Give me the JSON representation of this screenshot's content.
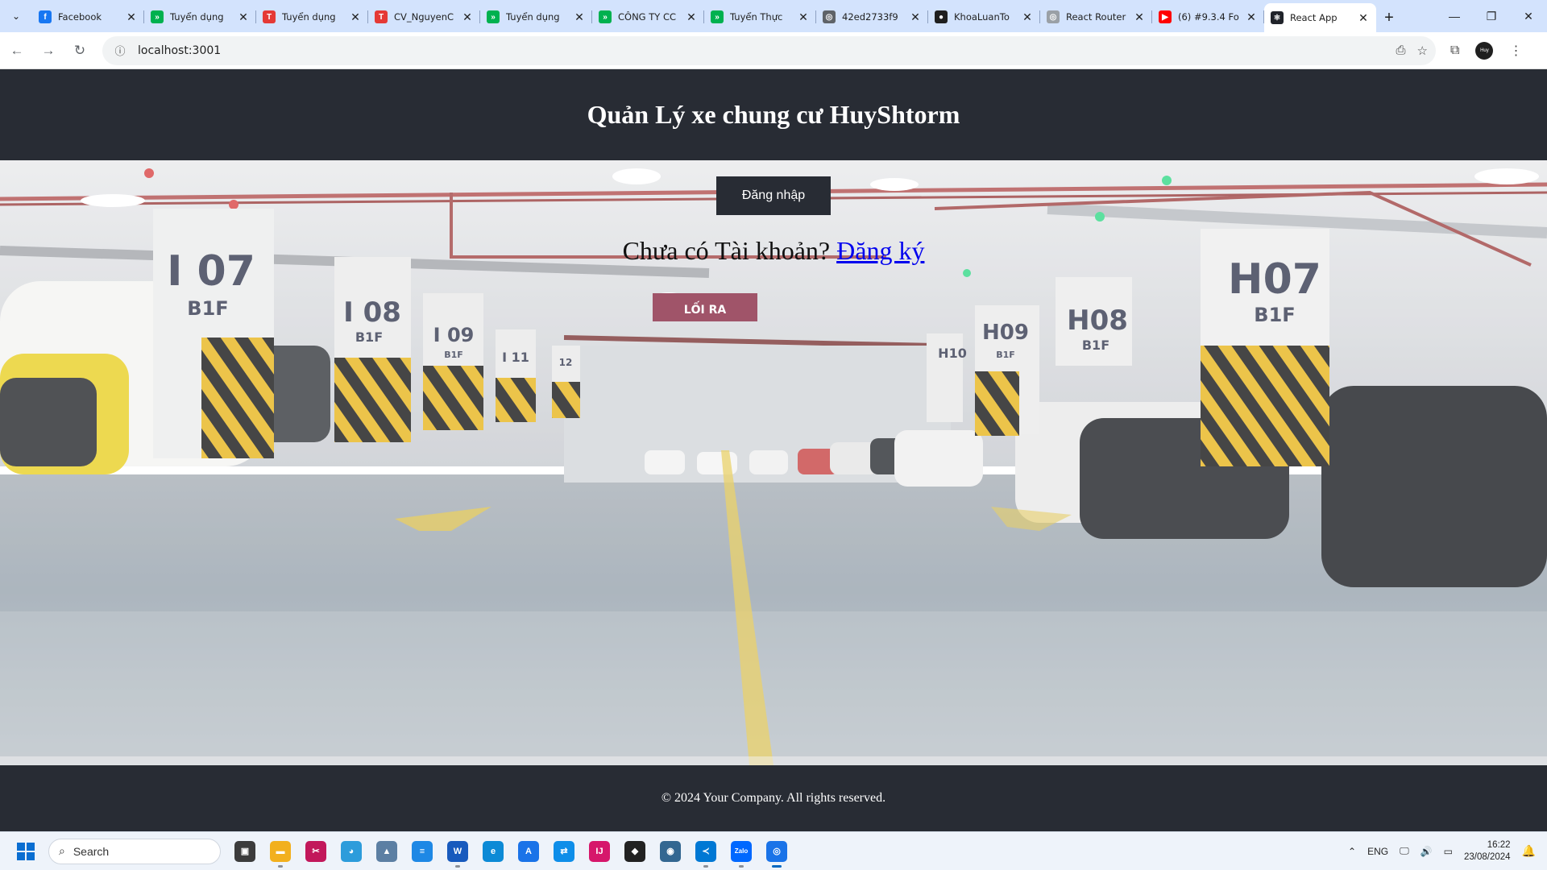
{
  "browser": {
    "tabs": [
      {
        "title": "Facebook",
        "icon": "facebook-icon",
        "color": "#1877f2",
        "glyph": "f"
      },
      {
        "title": "Tuyển dụng",
        "icon": "topcv-icon",
        "color": "#00b14f",
        "glyph": "»"
      },
      {
        "title": "Tuyển dụng",
        "icon": "topdev-icon",
        "color": "#e53935",
        "glyph": "T"
      },
      {
        "title": "CV_NguyenC",
        "icon": "topdev-icon",
        "color": "#e53935",
        "glyph": "T"
      },
      {
        "title": "Tuyển dụng",
        "icon": "topcv-icon",
        "color": "#00b14f",
        "glyph": "»"
      },
      {
        "title": "CÔNG TY CC",
        "icon": "topcv-icon",
        "color": "#00b14f",
        "glyph": "»"
      },
      {
        "title": "Tuyển Thực",
        "icon": "topcv-icon",
        "color": "#00b14f",
        "glyph": "»"
      },
      {
        "title": "42ed2733f9",
        "icon": "globe-icon",
        "color": "#5f6368",
        "glyph": "◎"
      },
      {
        "title": "KhoaLuanTo",
        "icon": "github-icon",
        "color": "#1f1f1f",
        "glyph": "●"
      },
      {
        "title": "React Router",
        "icon": "react-router-icon",
        "color": "#9aa0a6",
        "glyph": "◎"
      },
      {
        "title": "(6) #9.3.4 Fo",
        "icon": "youtube-icon",
        "color": "#ff0000",
        "glyph": "▶"
      },
      {
        "title": "React App",
        "icon": "react-icon",
        "color": "#20232a",
        "glyph": "⚛"
      }
    ],
    "active_tab_index": 11,
    "url": "localhost:3001"
  },
  "page": {
    "header_title": "Quản Lý xe chung cư HuyShtorm",
    "login_button": "Đăng nhập",
    "register_prompt": "Chưa có Tài khoản?",
    "register_link": "Đăng ký",
    "footer_text": "© 2024 Your Company. All rights reserved."
  },
  "scene_labels": {
    "pillar_left_big": "I 07",
    "pillar_left_big_floor": "B1F",
    "pillar_i08": "I 08",
    "pillar_i08_floor": "B1F",
    "pillar_i09": "I 09",
    "pillar_i09_floor": "B1F",
    "pillar_i11": "I 11",
    "pillar_i12": "12",
    "exit_sign": "LỐI RA",
    "pillar_h10": "H10",
    "pillar_h09": "H09",
    "pillar_h09_floor": "B1F",
    "pillar_h08": "H08",
    "pillar_h08_floor": "B1F",
    "pillar_h07": "H07",
    "pillar_h07_floor": "B1F"
  },
  "taskbar": {
    "search_placeholder": "Search",
    "apps": [
      {
        "name": "task-view-icon",
        "color": "#3c3c3c",
        "glyph": "▣",
        "running": false
      },
      {
        "name": "file-explorer-icon",
        "color": "#f2b01e",
        "glyph": "▬",
        "running": true
      },
      {
        "name": "snipping-tool-icon",
        "color": "#c2185b",
        "glyph": "✂",
        "running": false
      },
      {
        "name": "photos-icon",
        "color": "#2d9cdb",
        "glyph": "◕",
        "running": false
      },
      {
        "name": "gallery-icon",
        "color": "#5c7fa3",
        "glyph": "▲",
        "running": false
      },
      {
        "name": "notepad-icon",
        "color": "#1e88e5",
        "glyph": "≡",
        "running": false
      },
      {
        "name": "word-icon",
        "color": "#185abd",
        "glyph": "W",
        "running": true
      },
      {
        "name": "edge-icon",
        "color": "#0c8ad6",
        "glyph": "e",
        "running": false
      },
      {
        "name": "azure-data-studio-icon",
        "color": "#1a73e8",
        "glyph": "A",
        "running": false
      },
      {
        "name": "teamviewer-icon",
        "color": "#0e8ee9",
        "glyph": "⇄",
        "running": false
      },
      {
        "name": "intellij-icon",
        "color": "#d6176b",
        "glyph": "IJ",
        "running": false
      },
      {
        "name": "unity-icon",
        "color": "#222222",
        "glyph": "◆",
        "running": false
      },
      {
        "name": "postgresql-icon",
        "color": "#336791",
        "glyph": "◉",
        "running": false
      },
      {
        "name": "vscode-icon",
        "color": "#0078d4",
        "glyph": "≺",
        "running": true
      },
      {
        "name": "zalo-icon",
        "color": "#0068ff",
        "glyph": "Zalo",
        "running": true
      },
      {
        "name": "chrome-icon",
        "color": "#1a73e8",
        "glyph": "◎",
        "running": true,
        "active": true
      }
    ],
    "tray_language": "ENG",
    "time": "16:22",
    "date": "23/08/2024"
  }
}
